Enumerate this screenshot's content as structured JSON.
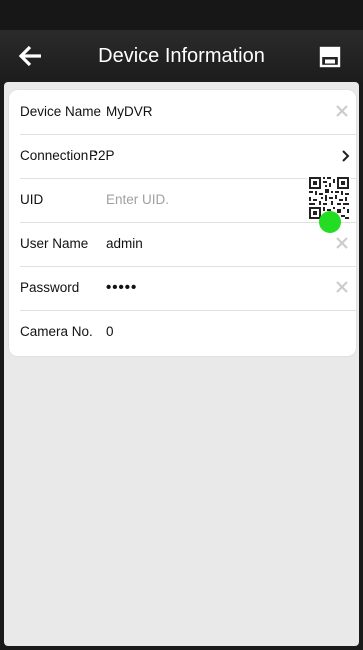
{
  "header": {
    "title": "Device Information",
    "back_icon": "arrow-left-icon",
    "save_icon": "floppy-save-icon"
  },
  "form": {
    "device_name": {
      "label": "Device Name",
      "value": "MyDVR"
    },
    "connection": {
      "label": "Connection ：",
      "value": "P2P"
    },
    "uid": {
      "label": "UID",
      "placeholder": "Enter UID.",
      "value": ""
    },
    "user_name": {
      "label": "User Name",
      "value": "admin"
    },
    "password": {
      "label": "Password",
      "value": "•••••"
    },
    "camera_no": {
      "label": "Camera No.",
      "value": "0"
    }
  },
  "icons": {
    "clear": "clear-x-icon",
    "chevron": "chevron-right-icon",
    "qr": "qr-code-icon"
  },
  "colors": {
    "nav_bg": "#222222",
    "content_bg": "#e9e9e9",
    "card_bg": "#ffffff",
    "touch_indicator": "#22dd22"
  }
}
